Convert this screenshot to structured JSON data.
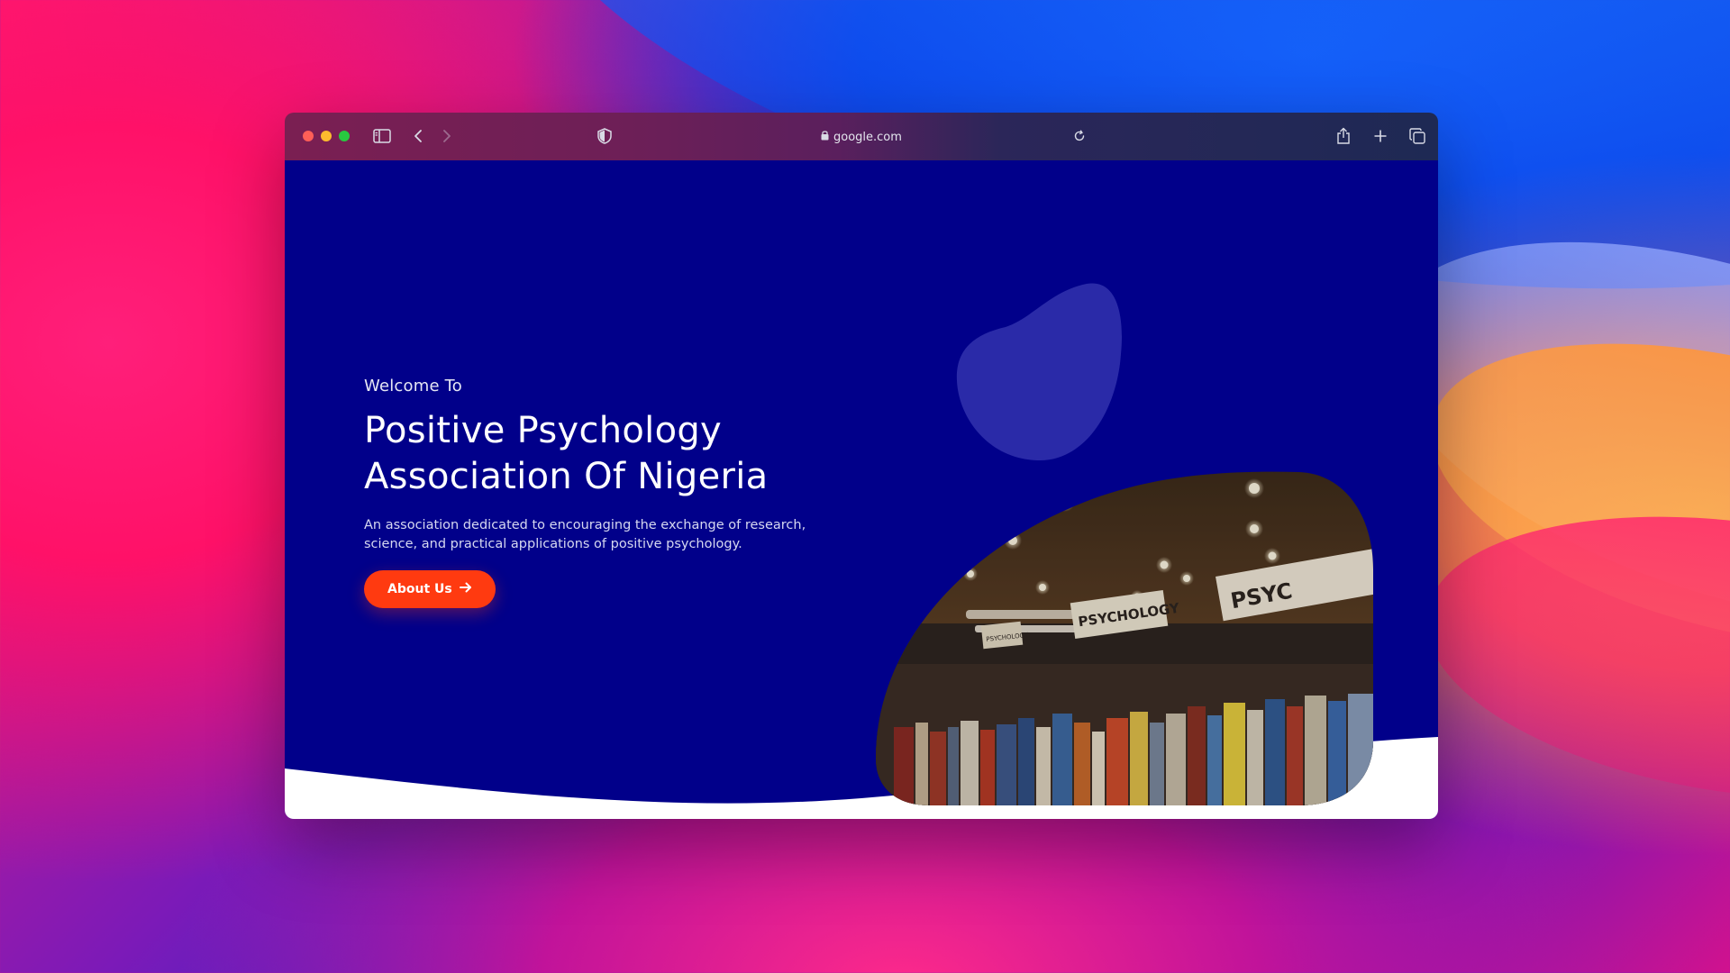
{
  "browser": {
    "url": "google.com",
    "icons": [
      "sidebar-icon",
      "chevron-left-icon",
      "chevron-right-icon",
      "shield-icon",
      "lock-icon",
      "reload-icon",
      "share-icon",
      "plus-icon",
      "tabs-icon"
    ]
  },
  "hero": {
    "welcome": "Welcome To",
    "title_line1": "Positive Psychology",
    "title_line2": "Association Of Nigeria",
    "description": "An association dedicated to encouraging the exchange of research, science, and practical applications of positive psychology.",
    "cta_label": "About Us"
  },
  "photo": {
    "sign_large": "PSYCHOLOGY",
    "sign_small": "PSYCHOLOGY",
    "sign_edge": "PSYC"
  },
  "colors": {
    "page_background": "#01008a",
    "cta": "#ff3a10",
    "blob": "#2a2aa8"
  }
}
